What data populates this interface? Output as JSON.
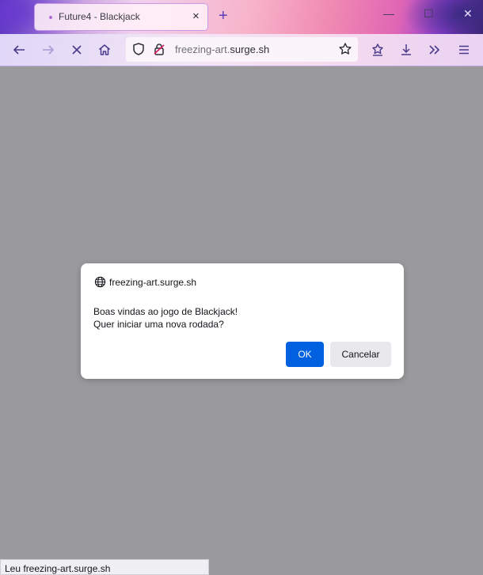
{
  "tab": {
    "title": "Future4 - Blackjack",
    "close_icon": "×"
  },
  "titlebar": {
    "new_tab_icon": "+",
    "minimize_icon": "—",
    "maximize_icon": "☐",
    "close_icon": "✕"
  },
  "urlbar": {
    "host_prefix": "freezing-art.",
    "host_main": "surge.sh"
  },
  "dialog": {
    "origin": "freezing-art.surge.sh",
    "message_line1": "Boas vindas ao jogo de Blackjack!",
    "message_line2": "Quer iniciar uma nova rodada?",
    "ok_label": "OK",
    "cancel_label": "Cancelar"
  },
  "status": {
    "text": "Leu freezing-art.surge.sh"
  },
  "colors": {
    "ok_button": "#0061e0",
    "accent": "#5b3fb8"
  },
  "icons": [
    "back-icon",
    "forward-icon",
    "stop-icon",
    "home-icon",
    "shield-icon",
    "lock-icon",
    "bookmark-star-icon",
    "pocket-icon",
    "download-icon",
    "overflow-icon",
    "menu-icon",
    "globe-icon"
  ]
}
